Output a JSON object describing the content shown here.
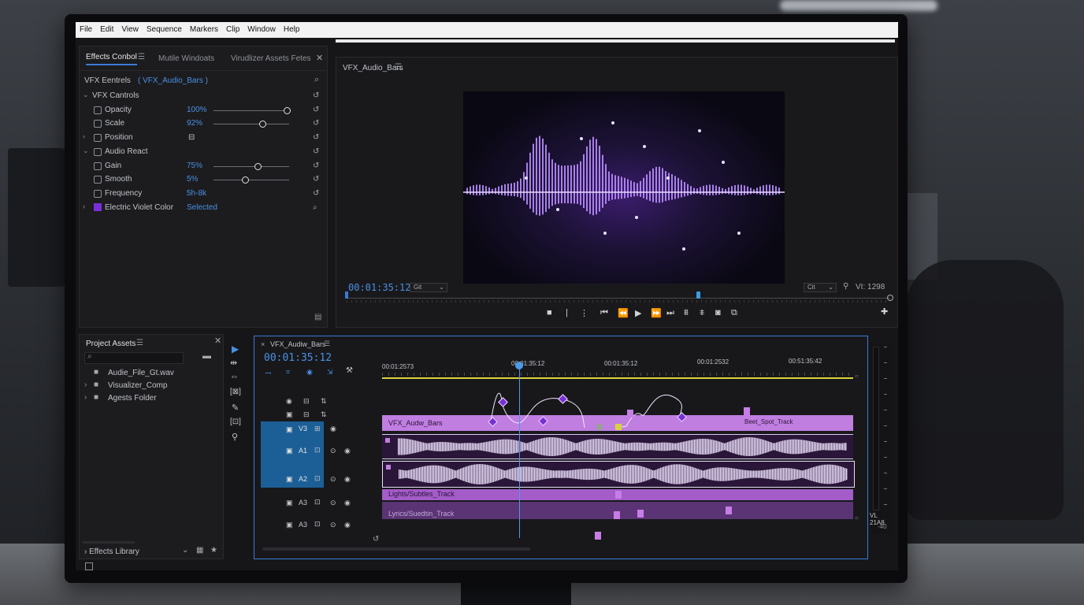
{
  "menu": [
    "File",
    "Edit",
    "View",
    "Sequence",
    "Markers",
    "Clip",
    "Window",
    "Help"
  ],
  "effects_panel": {
    "tabs": [
      "Effects Conbol",
      "Mutile Windoats",
      "Virudlizer Assets Fetes"
    ],
    "header_label": "VFX Eentrels",
    "header_clip": "( VFX_Audio_Bars )",
    "section": "VFX Cantrols",
    "rows": [
      {
        "label": "Opacity",
        "value": "100%",
        "level": 0.97
      },
      {
        "label": "Scale",
        "value": "92%",
        "level": 0.65
      },
      {
        "label": "Position",
        "value": ""
      },
      {
        "label": "Audio React",
        "value": ""
      },
      {
        "label": "Gain",
        "value": "75%",
        "level": 0.58
      },
      {
        "label": "Smooth",
        "value": "5%",
        "level": 0.42
      },
      {
        "label": "Frequency",
        "value": "5h-8k"
      },
      {
        "label": "Electric Violet Color",
        "value": "Selected"
      }
    ],
    "accent_color": "#7a2fd6"
  },
  "program": {
    "tab": "VFX_Audio_Bars",
    "timecode": "00:01:35:12",
    "zoom": "Git",
    "quality": "Cit",
    "right_readout": "VI: 1298"
  },
  "project": {
    "title": "Project Assets",
    "items": [
      "Audie_File_Gt.wav",
      "Visualizer_Comp",
      "Agests Folder"
    ],
    "footer": "Effects Library"
  },
  "timeline": {
    "tab": "VFX_Audiw_Bars",
    "timecode": "00:01:35:12",
    "ruler": [
      "00:01:2573",
      "00:01:35:12",
      "00:01:35:12",
      "00:01:2532",
      "00:51:35:42"
    ],
    "tracks": [
      "V3",
      "A1",
      "A2",
      "A3",
      "A3"
    ],
    "clip_labels": {
      "video": "VFX_Audw_Bars",
      "beat": "Beet_Spot_Track",
      "lyrics1": "Lights/Subtles_Track",
      "lyrics2": "Lyrics/Suedtin_Track"
    },
    "meter_top": "VL 21A8",
    "meter_bottom": "-40"
  }
}
